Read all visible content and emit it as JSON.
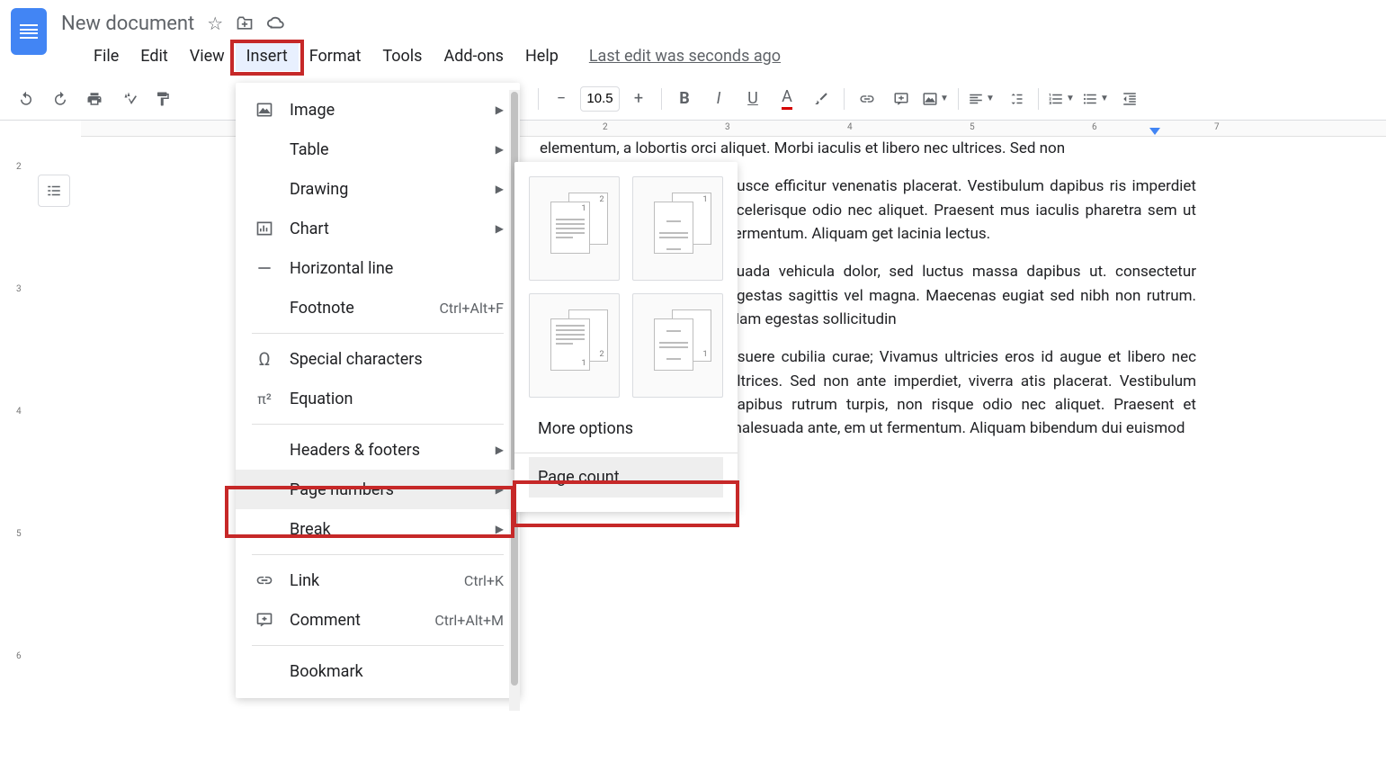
{
  "title": "New document",
  "menubar": [
    "File",
    "Edit",
    "View",
    "Insert",
    "Format",
    "Tools",
    "Add-ons",
    "Help"
  ],
  "active_menu_index": 3,
  "last_edit": "Last edit was seconds ago",
  "toolbar": {
    "font_size": "10.5"
  },
  "ruler_marks": [
    "2",
    "3",
    "4",
    "5",
    "6",
    "7"
  ],
  "vruler_marks": [
    "2",
    "3",
    "4",
    "5",
    "6"
  ],
  "dropdown": {
    "items": [
      {
        "icon": "image",
        "label": "Image",
        "arrow": true
      },
      {
        "icon": "table",
        "label": "Table",
        "arrow": true
      },
      {
        "icon": "drawing",
        "label": "Drawing",
        "arrow": true
      },
      {
        "icon": "chart",
        "label": "Chart",
        "arrow": true
      },
      {
        "icon": "hline",
        "label": "Horizontal line"
      },
      {
        "icon": "",
        "label": "Footnote",
        "shortcut": "Ctrl+Alt+F"
      },
      {
        "sep": true
      },
      {
        "icon": "omega",
        "label": "Special characters"
      },
      {
        "icon": "pi",
        "label": "Equation"
      },
      {
        "sep": true
      },
      {
        "icon": "",
        "label": "Headers & footers",
        "arrow": true
      },
      {
        "icon": "",
        "label": "Page numbers",
        "arrow": true,
        "hl": true
      },
      {
        "icon": "",
        "label": "Break",
        "arrow": true
      },
      {
        "sep": true
      },
      {
        "icon": "link",
        "label": "Link",
        "shortcut": "Ctrl+K"
      },
      {
        "icon": "comment",
        "label": "Comment",
        "shortcut": "Ctrl+Alt+M"
      },
      {
        "sep": true
      },
      {
        "icon": "",
        "label": "Bookmark"
      }
    ]
  },
  "submenu": {
    "more_options": "More options",
    "page_count": "Page count"
  },
  "doc_text": {
    "p1": "elementum, a lobortis orci aliquet. Morbi iaculis et libero nec ultrices. Sed non",
    "p2": "Fusce efficitur venenatis placerat. Vestibulum dapibus ris imperdiet scelerisque odio nec aliquet. Praesent mus iaculis pharetra sem ut fermentum. Aliquam get lacinia lectus.",
    "p3": "suada vehicula dolor, sed luctus massa dapibus ut. consectetur egestas sagittis vel magna. Maecenas eugiat sed nibh non rutrum. Nam egestas sollicitudin",
    "p4": "osuere cubilia curae; Vivamus ultricies eros id augue et libero nec ultrices. Sed non ante imperdiet, viverra atis placerat. Vestibulum dapibus rutrum turpis, non risque odio nec aliquet. Praesent et malesuada ante, em ut fermentum. Aliquam bibendum dui euismod"
  }
}
